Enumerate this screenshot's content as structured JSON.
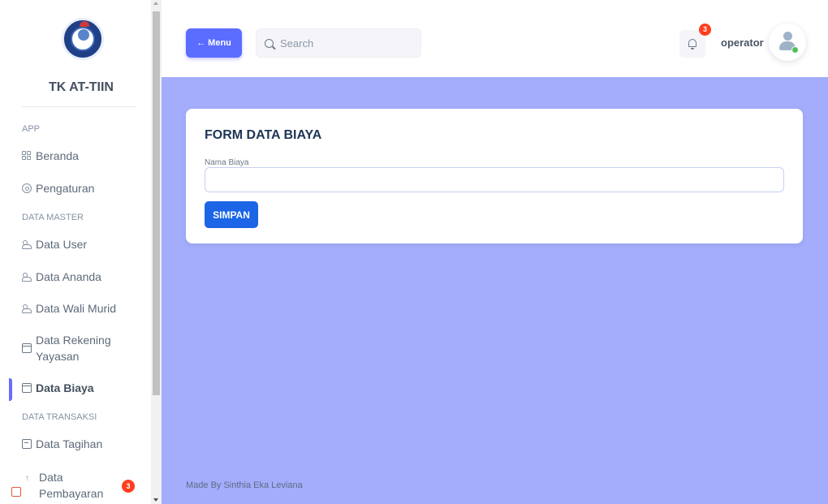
{
  "brand": {
    "name": "TK AT-TIIN"
  },
  "sidebar": {
    "sections": [
      {
        "header": "APP"
      },
      {
        "header": "DATA MASTER"
      },
      {
        "header": "DATA TRANSAKSI"
      }
    ],
    "items": [
      {
        "label": "Beranda",
        "icon": "grid-icon"
      },
      {
        "label": "Pengaturan",
        "icon": "gear-icon"
      },
      {
        "label": "Data User",
        "icon": "users-icon"
      },
      {
        "label": "Data Ananda",
        "icon": "users-icon"
      },
      {
        "label": "Data Wali Murid",
        "icon": "users-icon"
      },
      {
        "label_line1": "Data Rekening",
        "label_line2": "Yayasan",
        "icon": "card-icon"
      },
      {
        "label": "Data Biaya",
        "icon": "card-icon",
        "active": true
      },
      {
        "label": "Data Tagihan",
        "icon": "calendar-icon"
      },
      {
        "label_line1": "Data",
        "label_line2": "Pembayaran",
        "icon": "arrow-up-icon",
        "badge": "3"
      }
    ]
  },
  "navbar": {
    "menu_button_label": "← Menu",
    "search_placeholder": "Search",
    "notification_count": "3",
    "username": "operator"
  },
  "form": {
    "title": "FORM DATA BIAYA",
    "field_label": "Nama Biaya",
    "field_value": "",
    "submit_label": "SIMPAN"
  },
  "footer": {
    "text": "Made By Sinthia Eka Leviana"
  },
  "colors": {
    "primary": "#5b6dff",
    "content_bg": "#a3adfb",
    "button_blue": "#1b65e6",
    "badge_red": "#ff3e1d",
    "online_green": "#4fbf5b"
  }
}
